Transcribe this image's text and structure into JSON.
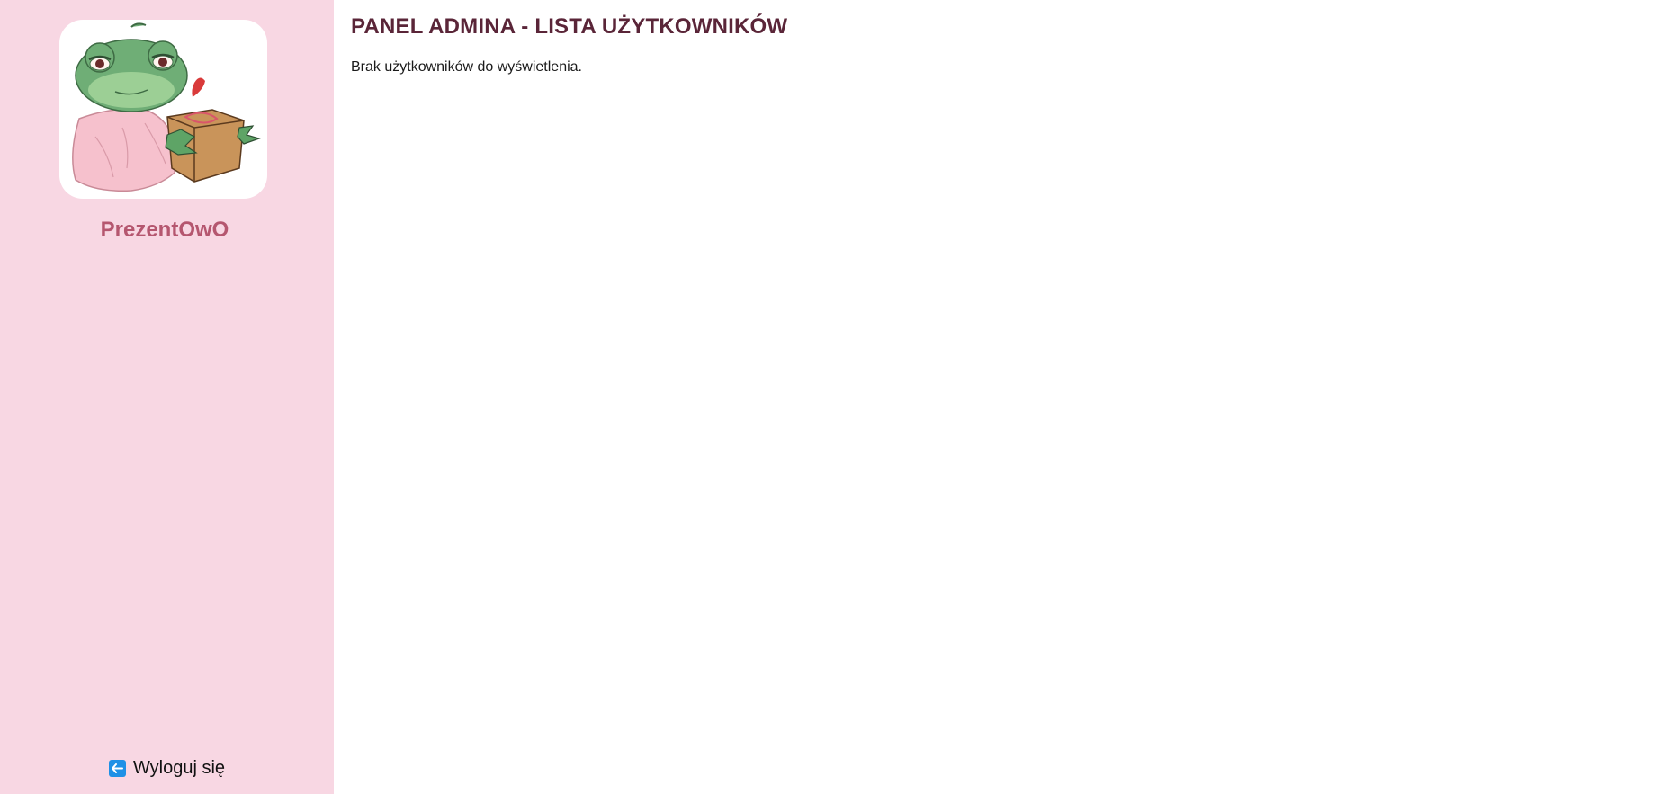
{
  "sidebar": {
    "brand_name": "PrezentOwO",
    "logo_icon": "frog-with-gift-icon",
    "logout_label": "Wyloguj się",
    "logout_icon": "arrow-left-icon",
    "background_color": "#f8d7e3",
    "brand_color": "#b5566f"
  },
  "main": {
    "title": "PANEL ADMINA - LISTA UŻYTKOWNIKÓW",
    "empty_message": "Brak użytkowników do wyświetlenia.",
    "title_color": "#5a2538"
  }
}
